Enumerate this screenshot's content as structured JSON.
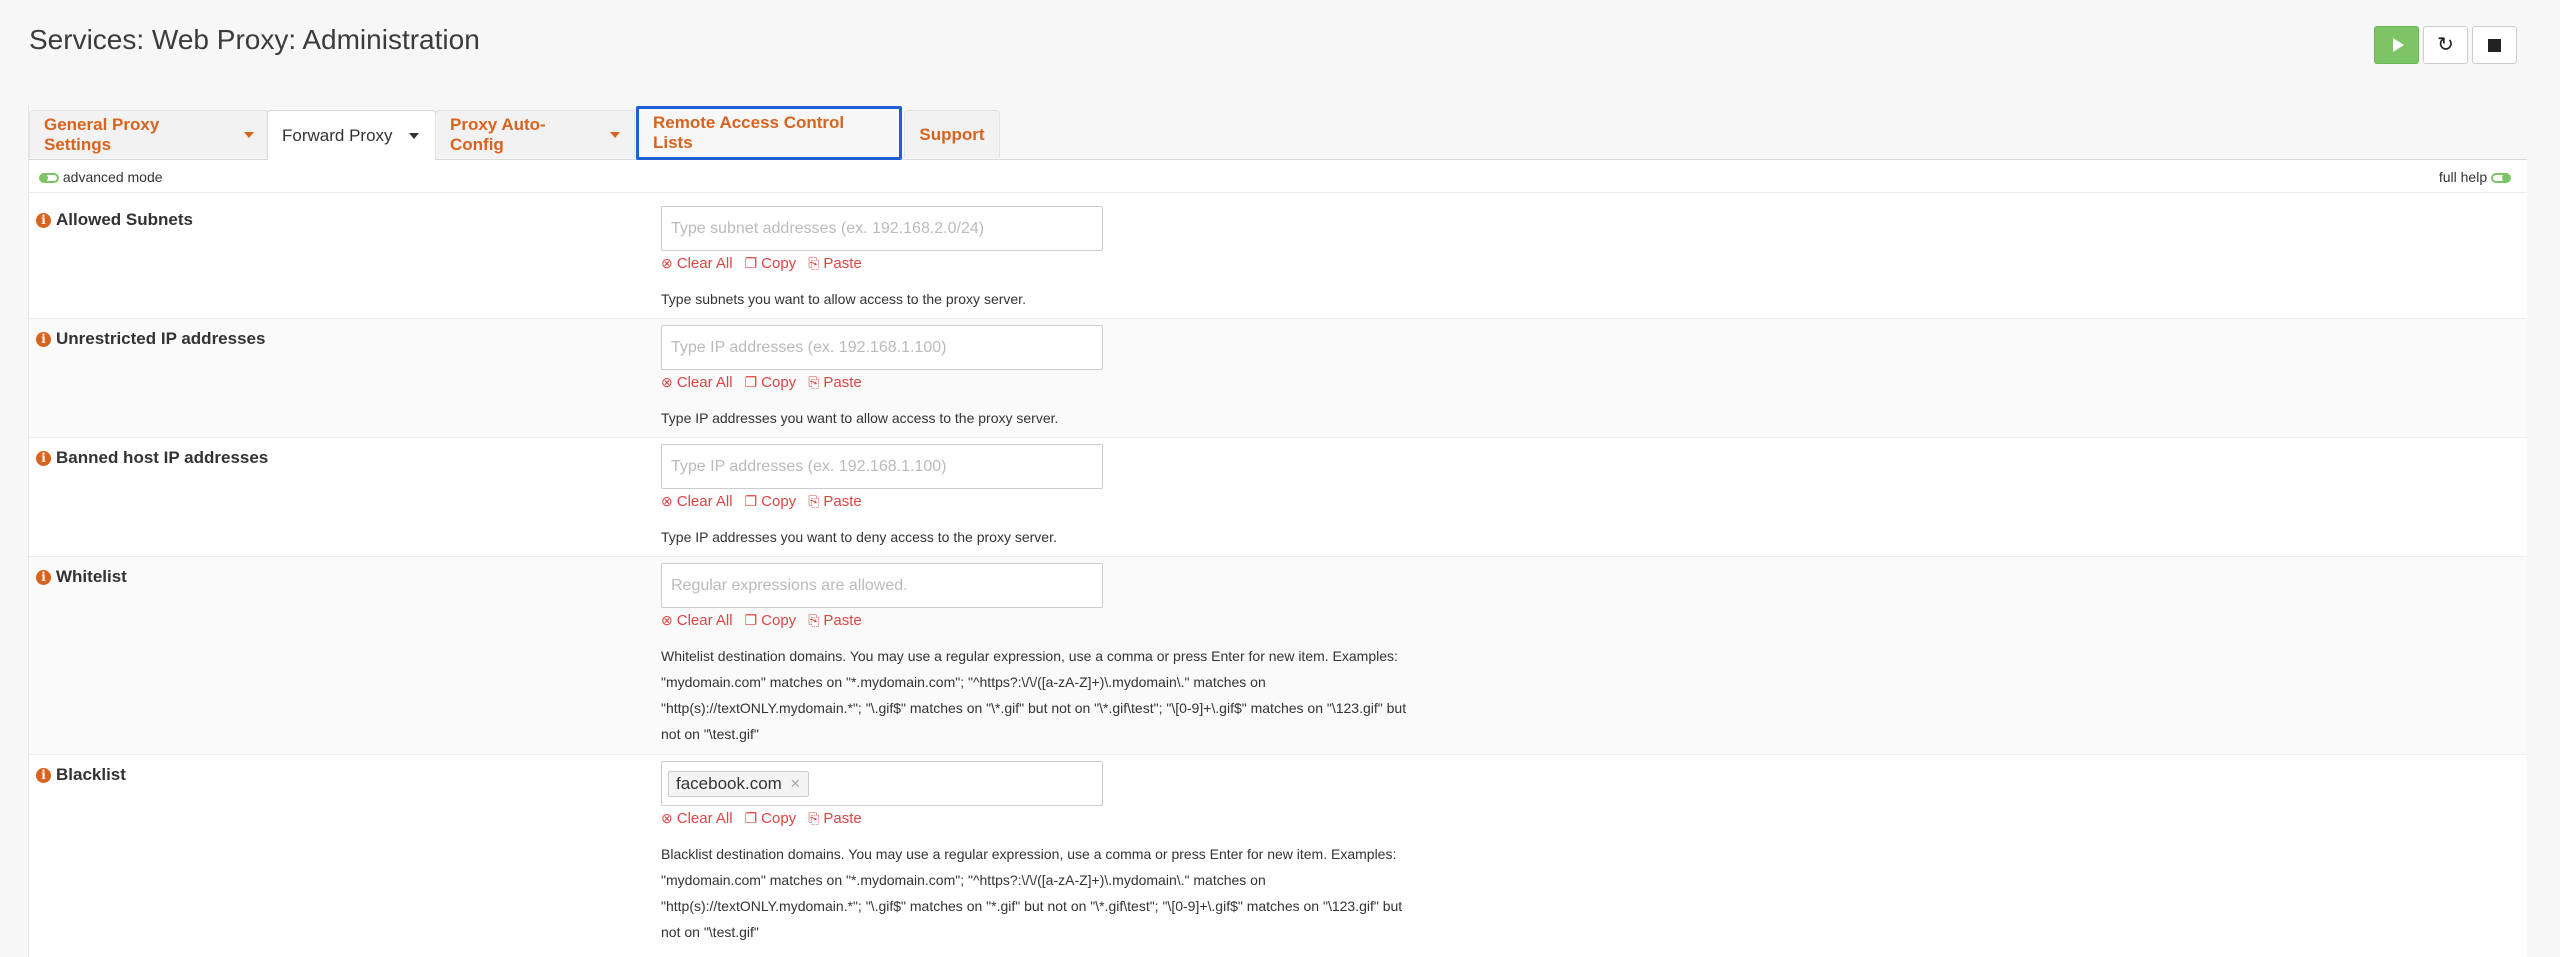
{
  "header": {
    "title": "Services: Web Proxy: Administration",
    "buttons": [
      {
        "name": "start-service",
        "icon": "play-icon"
      },
      {
        "name": "restart-service",
        "icon": "refresh-icon"
      },
      {
        "name": "stop-service",
        "icon": "stop-icon"
      }
    ]
  },
  "tabs": [
    {
      "label": "General Proxy Settings",
      "has_dropdown": true,
      "state": "normal"
    },
    {
      "label": "Forward Proxy",
      "has_dropdown": true,
      "state": "active"
    },
    {
      "label": "Proxy Auto-Config",
      "has_dropdown": true,
      "state": "normal"
    },
    {
      "label": "Remote Access Control Lists",
      "has_dropdown": false,
      "state": "highlighted"
    },
    {
      "label": "Support",
      "has_dropdown": false,
      "state": "normal"
    }
  ],
  "mode_bar": {
    "advanced_mode": "advanced mode",
    "full_help": "full help"
  },
  "actions": {
    "clear_all": "Clear All",
    "copy": "Copy",
    "paste": "Paste"
  },
  "rows": [
    {
      "label": "Allowed Subnets",
      "placeholder": "Type subnet addresses (ex. 192.168.2.0/24)",
      "help": "Type subnets you want to allow access to the proxy server."
    },
    {
      "label": "Unrestricted IP addresses",
      "placeholder": "Type IP addresses (ex. 192.168.1.100)",
      "help": "Type IP addresses you want to allow access to the proxy server."
    },
    {
      "label": "Banned host IP addresses",
      "placeholder": "Type IP addresses (ex. 192.168.1.100)",
      "help": "Type IP addresses you want to deny access to the proxy server."
    },
    {
      "label": "Whitelist",
      "placeholder": "Regular expressions are allowed.",
      "help_lines": [
        "Whitelist destination domains. You may use a regular expression, use a comma or press Enter for new item. Examples:",
        "\"mydomain.com\" matches on \"*.mydomain.com\"; \"^https?:\\/\\/([a-zA-Z]+)\\.mydomain\\.\" matches on",
        "\"http(s)://textONLY.mydomain.*\"; \"\\.gif$\" matches on \"\\*.gif\" but not on \"\\*.gif\\test\"; \"\\[0-9]+\\.gif$\" matches on \"\\123.gif\" but",
        "not on \"\\test.gif\""
      ]
    },
    {
      "label": "Blacklist",
      "tags": [
        "facebook.com"
      ],
      "help_lines": [
        "Blacklist destination domains. You may use a regular expression, use a comma or press Enter for new item. Examples:",
        "\"mydomain.com\" matches on \"*.mydomain.com\"; \"^https?:\\/\\/([a-zA-Z]+)\\.mydomain\\.\" matches on",
        "\"http(s)://textONLY.mydomain.*\"; \"\\.gif$\" matches on \"*.gif\" but not on \"\\*.gif\\test\"; \"\\[0-9]+\\.gif$\" matches on \"\\123.gif\" but",
        "not on \"\\test.gif\""
      ]
    }
  ],
  "colors": {
    "accent": "#d8631e",
    "action": "#dd4444",
    "success": "#7dc466",
    "highlight": "#1f5fd6"
  }
}
